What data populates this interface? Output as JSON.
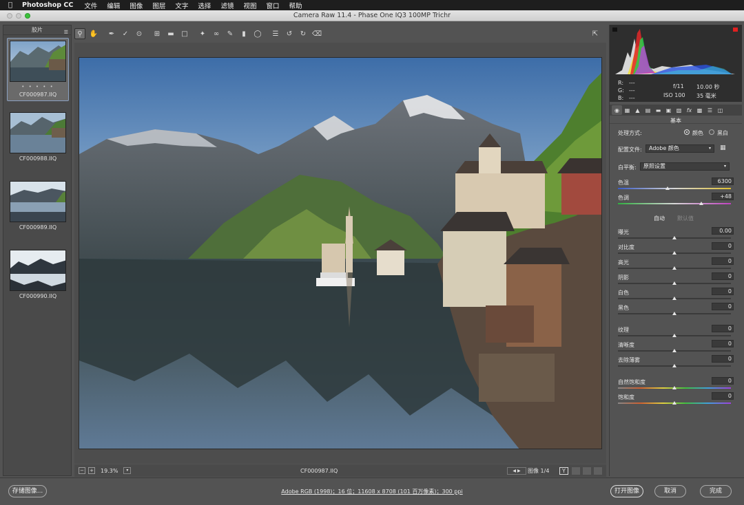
{
  "menubar": {
    "app": "Photoshop CC",
    "items": [
      "文件",
      "编辑",
      "图像",
      "图层",
      "文字",
      "选择",
      "滤镜",
      "视图",
      "窗口",
      "帮助"
    ]
  },
  "window": {
    "title": "Camera Raw 11.4 -  Phase One IQ3 100MP Trichr"
  },
  "filmstrip": {
    "header": "胶片",
    "items": [
      {
        "name": "CF000987.IIQ",
        "stars": "• • • • •"
      },
      {
        "name": "CF000988.IIQ"
      },
      {
        "name": "CF000989.IIQ"
      },
      {
        "name": "CF000990.IIQ"
      }
    ]
  },
  "status": {
    "zoom": "19.3%",
    "filename": "CF000987.IIQ",
    "image_counter": "图像 1/4"
  },
  "info": {
    "r": "R:",
    "g": "G:",
    "b": "B:",
    "rv": "---",
    "gv": "---",
    "bv": "---",
    "aperture": "f/11",
    "shutter": "10.00 秒",
    "iso": "ISO 100",
    "focal": "35 毫米"
  },
  "panel": {
    "section": "基本",
    "treatment_label": "处理方式:",
    "treatment_color": "颜色",
    "treatment_bw": "黑白",
    "profile_label": "配置文件:",
    "profile_value": "Adobe 颜色",
    "wb_label": "白平衡:",
    "wb_value": "原照设置",
    "auto": "自动",
    "default": "默认值",
    "sliders": [
      {
        "label": "色温",
        "value": "6300",
        "pos": 0.44
      },
      {
        "label": "色调",
        "value": "+48",
        "pos": 0.74
      },
      {
        "label": "曝光",
        "value": "0.00",
        "pos": 0.5
      },
      {
        "label": "对比度",
        "value": "0",
        "pos": 0.5
      },
      {
        "label": "高光",
        "value": "0",
        "pos": 0.5
      },
      {
        "label": "阴影",
        "value": "0",
        "pos": 0.5
      },
      {
        "label": "白色",
        "value": "0",
        "pos": 0.5
      },
      {
        "label": "黑色",
        "value": "0",
        "pos": 0.5
      },
      {
        "label": "纹理",
        "value": "0",
        "pos": 0.5
      },
      {
        "label": "清晰度",
        "value": "0",
        "pos": 0.5
      },
      {
        "label": "去除薄雾",
        "value": "0",
        "pos": 0.5
      },
      {
        "label": "自然饱和度",
        "value": "0",
        "pos": 0.5
      },
      {
        "label": "饱和度",
        "value": "0",
        "pos": 0.5
      }
    ]
  },
  "bottom": {
    "save": "存储图像...",
    "workflow": "Adobe RGB (1998)；16 位；11608 x 8708 (101 百万像素)；300 ppi",
    "open": "打开图像",
    "cancel": "取消",
    "done": "完成"
  },
  "colors": {
    "accent": "#8aa0c0",
    "panel_bg": "#535353"
  }
}
